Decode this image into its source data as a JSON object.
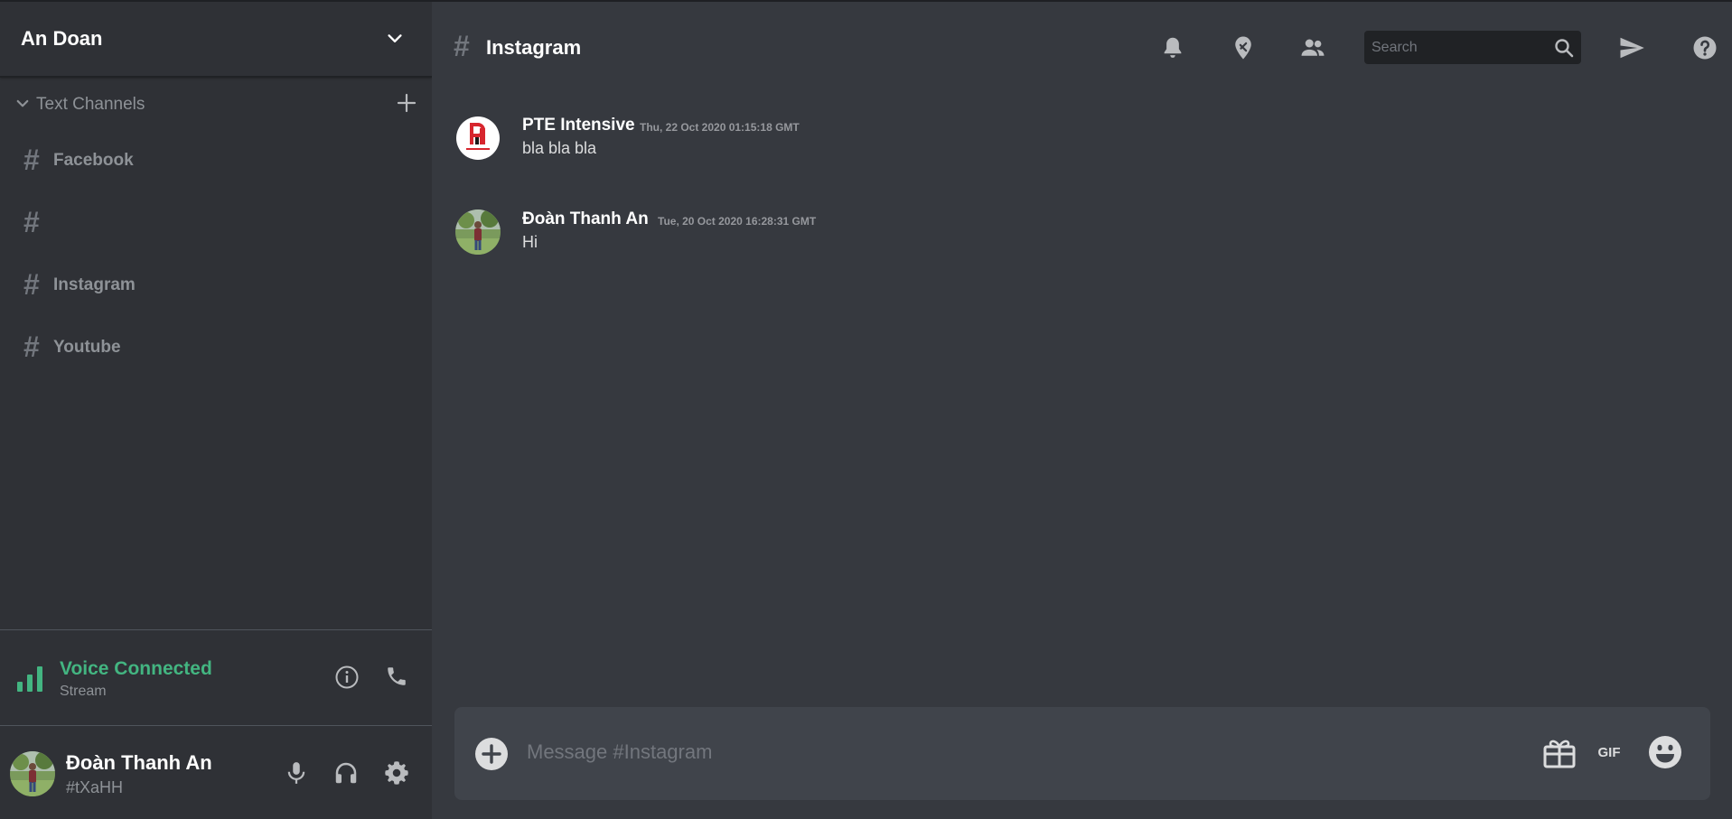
{
  "sidebar": {
    "server_name": "An Doan",
    "category": {
      "label": "Text Channels"
    },
    "channels": [
      {
        "hash": "#",
        "name": "Facebook"
      },
      {
        "hash": "#",
        "name": ""
      },
      {
        "hash": "#",
        "name": "Instagram"
      },
      {
        "hash": "#",
        "name": "Youtube"
      }
    ],
    "voice": {
      "title": "Voice Connected",
      "subtitle": "Stream"
    },
    "user": {
      "name": "Đoàn Thanh An",
      "tag": "#tXaHH"
    }
  },
  "header": {
    "hash": "#",
    "channel_title": "Instagram",
    "search_placeholder": "Search"
  },
  "messages": [
    {
      "author": "PTE Intensive",
      "timestamp": "Thu, 22 Oct 2020 01:15:18 GMT",
      "text": "bla bla bla"
    },
    {
      "author": "Đoàn Thanh An",
      "timestamp": "Tue, 20 Oct 2020 16:28:31 GMT",
      "text": "Hi"
    }
  ],
  "composer": {
    "placeholder": "Message #Instagram",
    "gif_label": "GIF"
  },
  "icons": {
    "server_dropdown": "chevron-down-icon",
    "category_collapse": "chevron-down-icon",
    "add_channel": "plus-icon",
    "voice_signal": "signal-bars-icon",
    "voice_info": "info-icon",
    "voice_disconnect": "phone-icon",
    "mute": "microphone-icon",
    "deafen": "headphones-icon",
    "settings": "gear-icon",
    "notifications": "bell-icon",
    "pinned": "pin-icon",
    "members": "members-icon",
    "search": "search-icon",
    "inbox": "send-icon",
    "help": "help-icon",
    "attach": "plus-circle-icon",
    "gift": "gift-icon",
    "emoji": "emoji-icon"
  },
  "colors": {
    "sidebar_bg": "#2f3136",
    "main_bg": "#36393f",
    "composer_bg": "#40444b",
    "voice_green": "#43b581",
    "muted_text": "#8e9297",
    "icon_gray": "#b9bbbe"
  }
}
